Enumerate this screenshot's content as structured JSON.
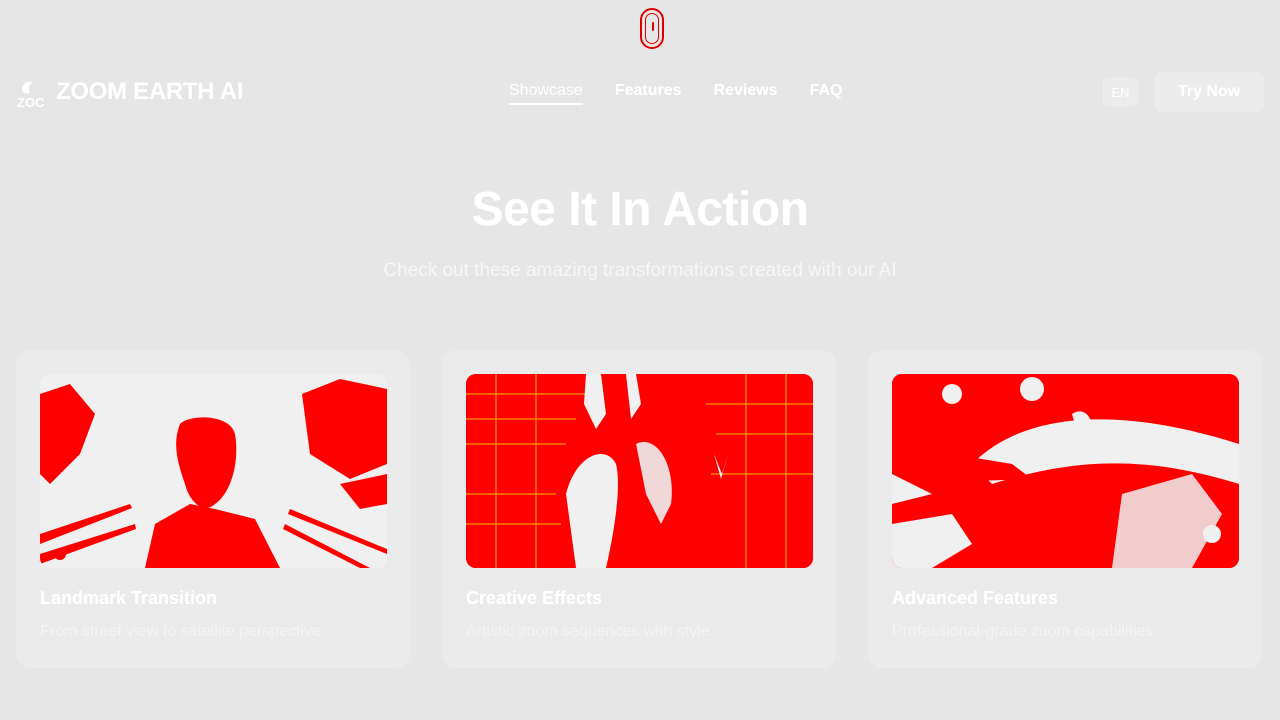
{
  "header": {
    "brand": "ZOOM EARTH AI",
    "logo_fragment": "ZOC",
    "nav": [
      {
        "label": "Showcase",
        "active": true
      },
      {
        "label": "Features",
        "active": false
      },
      {
        "label": "Reviews",
        "active": false
      },
      {
        "label": "FAQ",
        "active": false
      }
    ],
    "lang_label": "EN",
    "cta_label": "Try Now"
  },
  "hero": {
    "title": "See It In Action",
    "subtitle": "Check out these amazing transformations created with our AI"
  },
  "cards": [
    {
      "title": "Landmark Transition",
      "description": "From street view to satellite perspective"
    },
    {
      "title": "Creative Effects",
      "description": "Artistic zoom sequences with style"
    },
    {
      "title": "Advanced Features",
      "description": "Professional-grade zoom capabilities"
    }
  ],
  "colors": {
    "background": "#e6e6e6",
    "accent": "#ff0000",
    "text": "#ffffff"
  },
  "icons": {
    "scroll_indicator": "mouse-scroll-icon",
    "logo": "zoom-earth-logo-icon"
  }
}
